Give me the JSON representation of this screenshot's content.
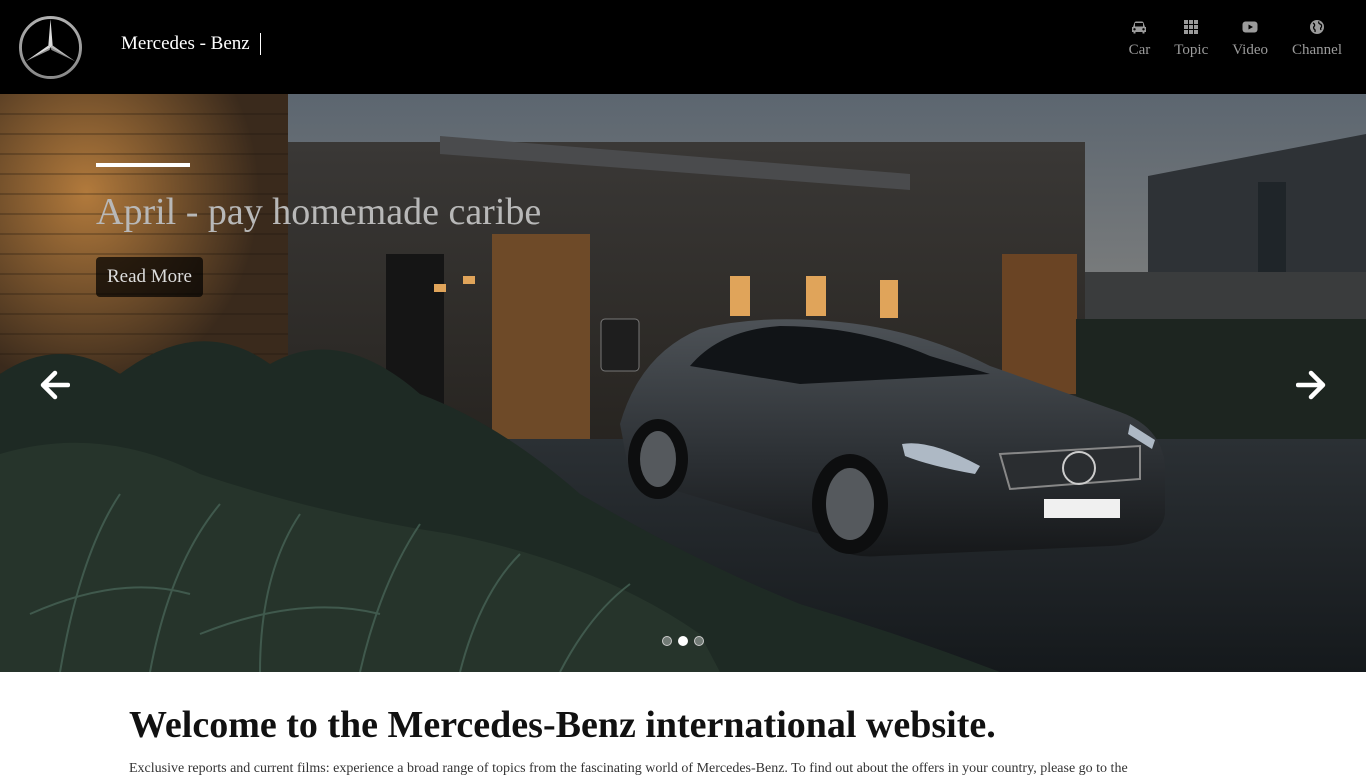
{
  "header": {
    "brand": "Mercedes - Benz",
    "nav": [
      {
        "label": "Car",
        "icon": "car-icon"
      },
      {
        "label": "Topic",
        "icon": "grid-icon"
      },
      {
        "label": "Video",
        "icon": "youtube-icon"
      },
      {
        "label": "Channel",
        "icon": "globe-icon"
      }
    ]
  },
  "hero": {
    "title": "April - pay homemade caribe",
    "button_label": "Read More",
    "slide_count": 3,
    "active_slide": 2
  },
  "welcome": {
    "title": "Welcome to the Mercedes-Benz international website.",
    "text": "Exclusive reports and current films: experience a broad range of topics from the fascinating world of Mercedes-Benz. To find out about the offers in your country, please go to the"
  },
  "colors": {
    "header_bg": "#000000",
    "nav_text": "#9b9b9b",
    "hero_title": "#b8b8b8"
  }
}
